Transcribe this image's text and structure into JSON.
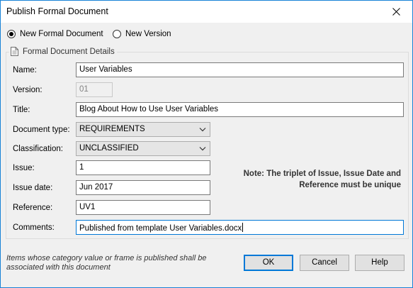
{
  "window": {
    "title": "Publish Formal Document"
  },
  "mode": {
    "new_formal_document_label": "New Formal Document",
    "new_version_label": "New Version",
    "selected": "New Formal Document"
  },
  "group": {
    "title": "Formal Document Details",
    "icon": "document-icon"
  },
  "fields": {
    "name": {
      "label": "Name:",
      "value": "User Variables"
    },
    "version": {
      "label": "Version:",
      "value": "01"
    },
    "title": {
      "label": "Title:",
      "value": "Blog About How to Use User Variables"
    },
    "document_type": {
      "label": "Document type:",
      "value": "REQUIREMENTS"
    },
    "classification": {
      "label": "Classification:",
      "value": "UNCLASSIFIED"
    },
    "issue": {
      "label": "Issue:",
      "value": "1"
    },
    "issue_date": {
      "label": "Issue date:",
      "value": "Jun 2017"
    },
    "reference": {
      "label": "Reference:",
      "value": "UV1"
    },
    "comments": {
      "label": "Comments:",
      "value": "Published from template User Variables.docx"
    }
  },
  "note": {
    "line1": "Note: The triplet of Issue, Issue Date and",
    "line2": "Reference must be unique"
  },
  "footer": {
    "line1": "Items whose category value or frame is published shall be",
    "line2": "associated with this document"
  },
  "buttons": {
    "ok": "OK",
    "cancel": "Cancel",
    "help": "Help"
  },
  "colors": {
    "accent": "#0078d7",
    "window_border": "#1883d7",
    "background": "#f0f0f0"
  }
}
